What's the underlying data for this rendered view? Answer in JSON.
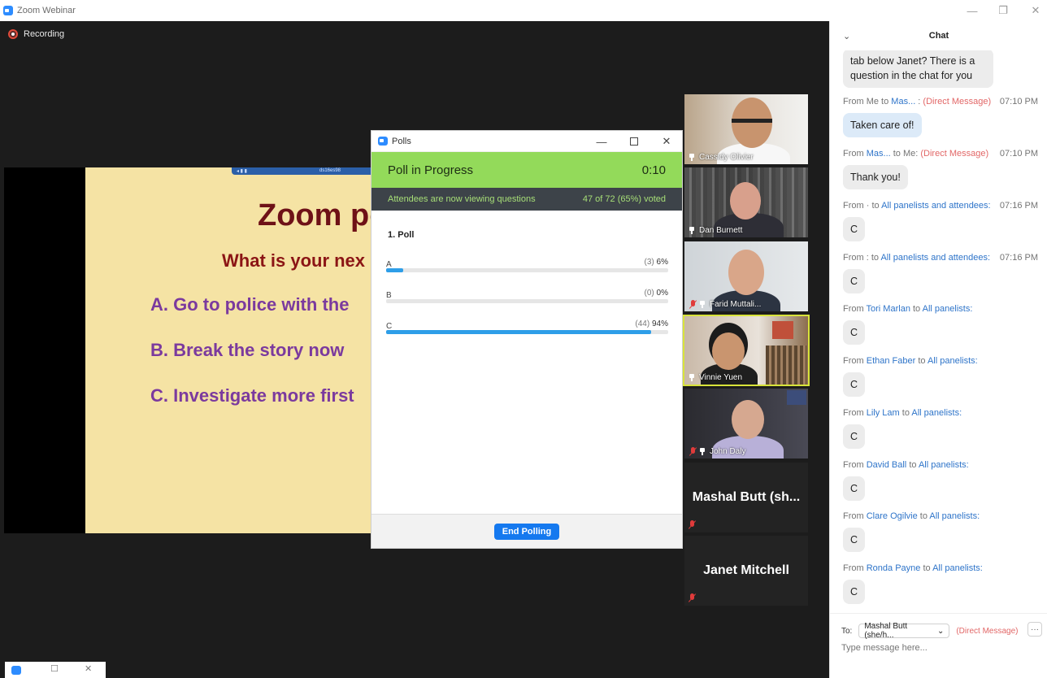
{
  "window": {
    "title": "Zoom Webinar",
    "minimize_icon": "—",
    "restore_icon": "❐",
    "close_icon": "✕"
  },
  "recording": {
    "label": "Recording"
  },
  "slide": {
    "title": "Zoom po",
    "question": "What is your nex",
    "options": [
      "A.  Go to police with the",
      "B.  Break the story now",
      "C.  Investigate more first"
    ],
    "toolbar_text": "ds16es98"
  },
  "polls": {
    "window_title": "Polls",
    "status": "Poll  in Progress",
    "timer": "0:10",
    "info": "Attendees are now viewing questions",
    "voted": "47 of 72 (65%) voted",
    "poll_name": "1. Poll",
    "options": [
      {
        "label": "A",
        "count": "(3)",
        "percent": "6%",
        "fraction": 0.06
      },
      {
        "label": "B",
        "count": "(0)",
        "percent": "0%",
        "fraction": 0.0
      },
      {
        "label": "C",
        "count": "(44)",
        "percent": "94%",
        "fraction": 0.94
      }
    ],
    "end_button": "End Polling"
  },
  "participants": [
    {
      "name": "Cassidy Olivier"
    },
    {
      "name": "Dan Burnett"
    },
    {
      "name": "Farid Muttali..."
    },
    {
      "name": "Vinnie Yuen"
    },
    {
      "name": "John Daly"
    },
    {
      "name": "Mashal  Butt  (sh..."
    },
    {
      "name": "Janet Mitchell"
    }
  ],
  "chat": {
    "title": "Chat",
    "messages": [
      {
        "from": "",
        "to": "",
        "dm": "",
        "time": "",
        "text": "tab below Janet? There is a question in the chat for you"
      },
      {
        "from": "From Me to ",
        "to": "Mas...",
        "sep": " : ",
        "dm": "(Direct Message)",
        "time": "07:10 PM",
        "text": "Taken care of!"
      },
      {
        "from": "From ",
        "to": "Mas...",
        "sep": "   to Me: ",
        "dm": "(Direct Message)",
        "time": "07:10 PM",
        "text": "Thank you!"
      },
      {
        "from": "From · to ",
        "to": "All panelists and attendees:",
        "sep": "",
        "dm": "",
        "time": "07:16 PM",
        "text": "C"
      },
      {
        "from": "From : to ",
        "to": "All panelists and attendees:",
        "sep": "",
        "dm": "",
        "time": "07:16 PM",
        "text": "C"
      },
      {
        "from": "From ",
        "to": "Tori Marlan",
        "sep": " to ",
        "dm": "",
        "to2": "All panelists:",
        "time": "",
        "text": "C"
      },
      {
        "from": "From ",
        "to": "Ethan Faber",
        "sep": " to ",
        "dm": "",
        "to2": "All panelists:",
        "time": "",
        "text": "C"
      },
      {
        "from": "From ",
        "to": "Lily Lam",
        "sep": " to ",
        "dm": "",
        "to2": "All panelists:",
        "time": "",
        "text": "C"
      },
      {
        "from": "From ",
        "to": "David Ball",
        "sep": " to ",
        "dm": "",
        "to2": "All panelists:",
        "time": "",
        "text": "C"
      },
      {
        "from": "From ",
        "to": "Clare Ogilvie",
        "sep": " to ",
        "dm": "",
        "to2": "All panelists:",
        "time": "",
        "text": "C"
      },
      {
        "from": "From ",
        "to": "Ronda Payne",
        "sep": " to ",
        "dm": "",
        "to2": "All panelists:",
        "time": "",
        "text": "C"
      }
    ],
    "to_label": "To:",
    "recipient": "Mashal Butt (she/h...",
    "recipient_dm": "(Direct Message)",
    "more": "···",
    "input_placeholder": "Type message here..."
  },
  "colors": {
    "accent": "#2d8cff",
    "poll_green": "#93da5a",
    "bar_blue": "#2e9ee8",
    "dm_red": "#e26767",
    "link_blue": "#2e74c9"
  }
}
